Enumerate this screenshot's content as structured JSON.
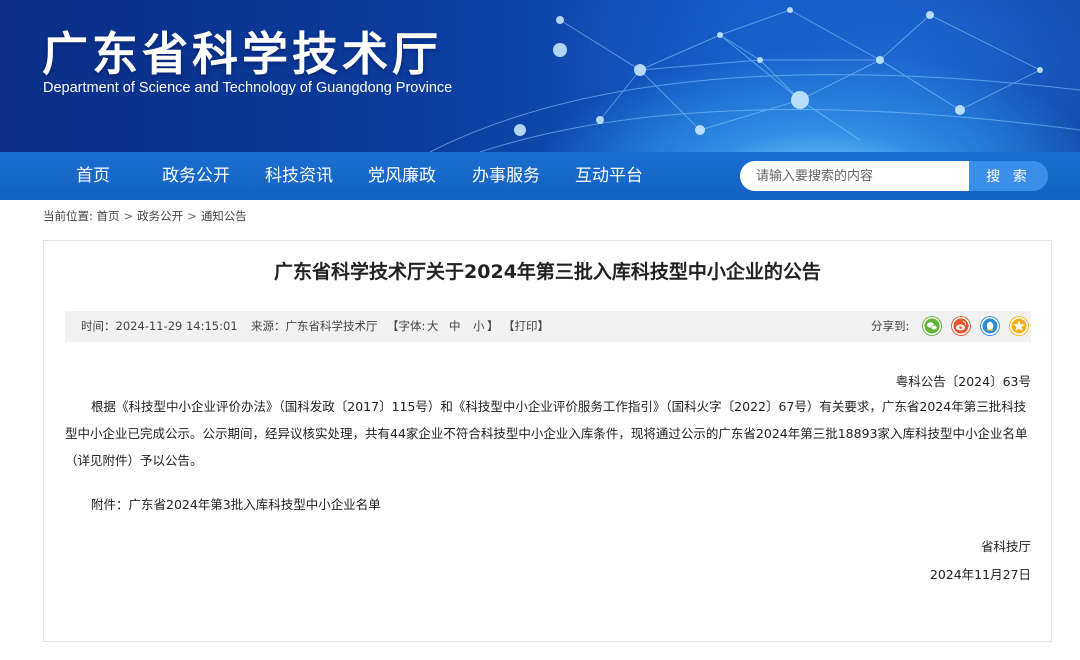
{
  "site": {
    "title": "广东省科学技术厅",
    "subtitle": "Department of Science and Technology of Guangdong Province"
  },
  "nav": {
    "items": [
      "首页",
      "政务公开",
      "科技资讯",
      "党风廉政",
      "办事服务",
      "互动平台"
    ]
  },
  "search": {
    "placeholder": "请输入要搜索的内容",
    "button_label": "搜 索"
  },
  "breadcrumb": {
    "prefix": "当前位置:",
    "items": [
      "首页",
      "政务公开",
      "通知公告"
    ],
    "separator": ">"
  },
  "article": {
    "title": "广东省科学技术厅关于2024年第三批入库科技型中小企业的公告",
    "meta": {
      "time": "时间：2024-11-29 14:15:01",
      "source": "来源：广东省科学技术厅",
      "font_label": "【字体:",
      "font_large": "大",
      "font_medium": "中",
      "font_small": "小",
      "font_close": "】",
      "print": "【打印】",
      "share_label": "分享到:"
    },
    "doc_number": "粤科公告〔2024〕63号",
    "body": "根据《科技型中小企业评价办法》（国科发政〔2017〕115号）和《科技型中小企业评价服务工作指引》（国科火字〔2022〕67号）有关要求，广东省2024年第三批科技型中小企业已完成公示。公示期间，经异议核实处理，共有44家企业不符合科技型中小企业入库条件，现将通过公示的广东省2024年第三批18893家入库科技型中小企业名单（详见附件）予以公告。",
    "attachment": "附件：广东省2024年第3批入库科技型中小企业名单",
    "signature": "省科技厅",
    "date": "2024年11月27日"
  },
  "colors": {
    "banner_dark": "#0a2e86",
    "nav_blue": "#1a6fd0",
    "search_button": "#3b8fea",
    "share_wechat": "#5cb531",
    "share_weibo": "#e8562e",
    "share_qq": "#2e8fd8",
    "share_qzone": "#f5b21b"
  }
}
